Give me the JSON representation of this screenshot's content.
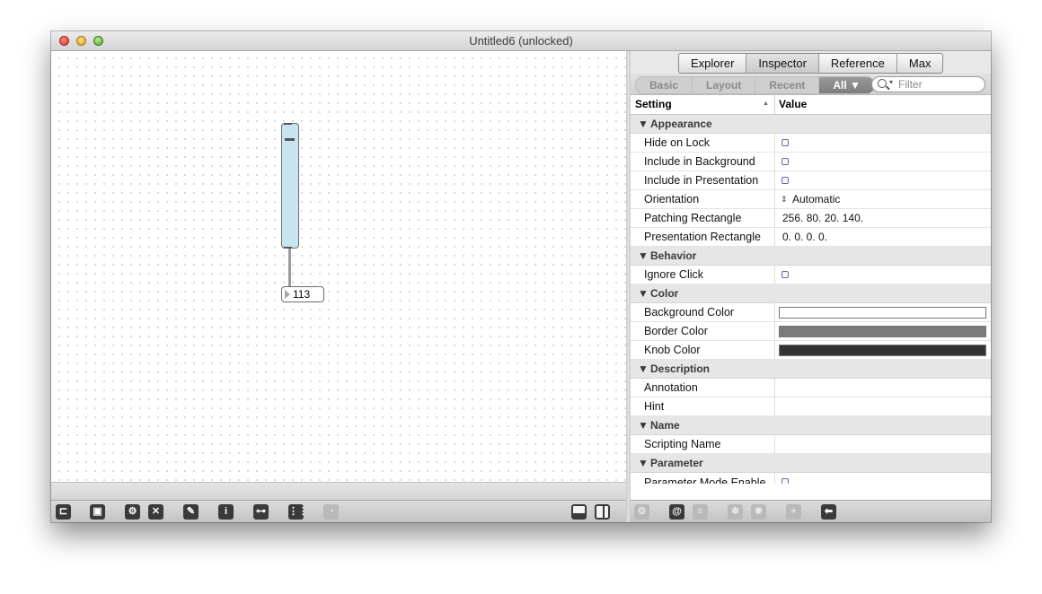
{
  "window": {
    "title": "Untitled6 (unlocked)"
  },
  "patcher": {
    "number_value": "113"
  },
  "inspector": {
    "tabs": [
      {
        "label": "Explorer"
      },
      {
        "label": "Inspector"
      },
      {
        "label": "Reference"
      },
      {
        "label": "Max"
      }
    ],
    "filter_tabs": [
      {
        "label": "Basic"
      },
      {
        "label": "Layout"
      },
      {
        "label": "Recent"
      },
      {
        "label": "All ▼"
      }
    ],
    "filter_placeholder": "Filter",
    "columns": {
      "setting": "Setting",
      "value": "Value",
      "sort_glyph": "▲"
    },
    "groups": [
      {
        "title": "Appearance",
        "rows": [
          {
            "label": "Hide on Lock",
            "type": "checkbox"
          },
          {
            "label": "Include in Background",
            "type": "checkbox"
          },
          {
            "label": "Include in Presentation",
            "type": "checkbox"
          },
          {
            "label": "Orientation",
            "type": "menu",
            "value": "Automatic"
          },
          {
            "label": "Patching Rectangle",
            "type": "text",
            "value": "256. 80. 20. 140."
          },
          {
            "label": "Presentation Rectangle",
            "type": "text",
            "value": "0. 0. 0. 0."
          }
        ]
      },
      {
        "title": "Behavior",
        "rows": [
          {
            "label": "Ignore Click",
            "type": "checkbox"
          }
        ]
      },
      {
        "title": "Color",
        "rows": [
          {
            "label": "Background Color",
            "type": "color",
            "value": "#ffffff"
          },
          {
            "label": "Border Color",
            "type": "color",
            "value": "#7a7a7a"
          },
          {
            "label": "Knob Color",
            "type": "color",
            "value": "#333333"
          }
        ]
      },
      {
        "title": "Description",
        "rows": [
          {
            "label": "Annotation",
            "type": "text",
            "value": ""
          },
          {
            "label": "Hint",
            "type": "text",
            "value": ""
          }
        ]
      },
      {
        "title": "Name",
        "rows": [
          {
            "label": "Scripting Name",
            "type": "text",
            "value": ""
          }
        ]
      },
      {
        "title": "Parameter",
        "rows": [
          {
            "label": "Parameter Mode Enable",
            "type": "checkbox",
            "partial": true
          }
        ]
      }
    ]
  },
  "colors": {
    "slider_fill": "#c8e4f0",
    "accent_tab": "#8a8a8a"
  }
}
